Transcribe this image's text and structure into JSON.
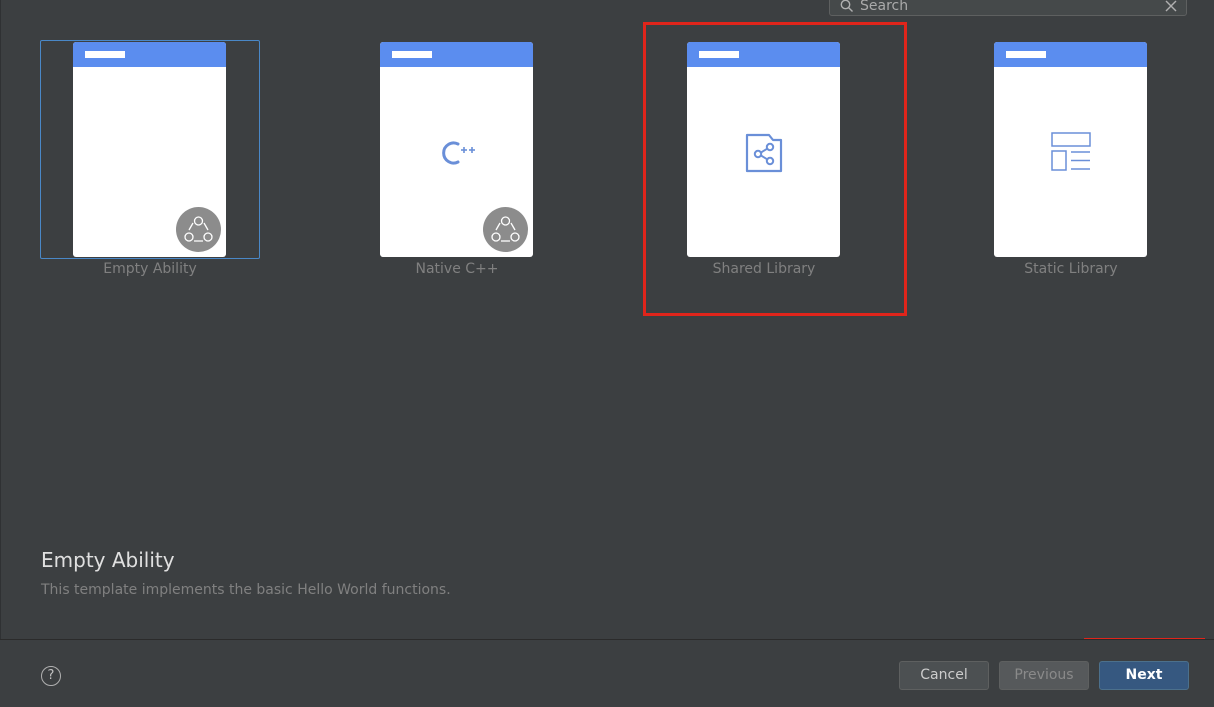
{
  "search": {
    "placeholder": "Search",
    "icon": "search-icon",
    "clear_icon": "close-icon"
  },
  "templates": [
    {
      "label": "Empty Ability",
      "icon": "ability-badge-icon",
      "selected": true
    },
    {
      "label": "Native C++",
      "icon": "cpp-icon",
      "badge": "ability-badge-icon"
    },
    {
      "label": "Shared Library",
      "icon": "shared-library-icon"
    },
    {
      "label": "Static Library",
      "icon": "static-library-icon"
    }
  ],
  "description": {
    "title": "Empty Ability",
    "text": "This template implements the basic Hello World functions."
  },
  "footer": {
    "help_label": "?",
    "cancel_label": "Cancel",
    "previous_label": "Previous",
    "next_label": "Next"
  },
  "colors": {
    "background": "#3c3f41",
    "card_header": "#5b8def",
    "selection_border": "#4a88c7",
    "highlight": "#e0251b",
    "next_button": "#365880"
  }
}
